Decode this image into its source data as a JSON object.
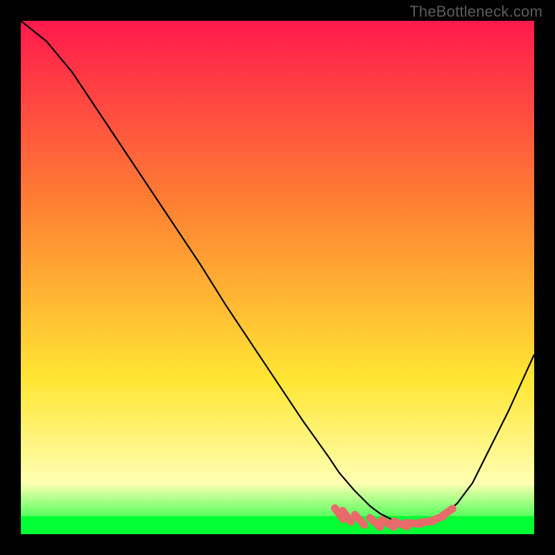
{
  "watermark": "TheBottleneck.com",
  "chart_data": {
    "type": "line",
    "title": "",
    "xlabel": "",
    "ylabel": "",
    "xlim": [
      0,
      100
    ],
    "ylim": [
      0,
      100
    ],
    "curve": {
      "name": "bottleneck-curve",
      "color": "#000000",
      "x": [
        0,
        5,
        10,
        15,
        20,
        25,
        30,
        35,
        40,
        45,
        50,
        55,
        60,
        62,
        65,
        68,
        70,
        73,
        75,
        78,
        80,
        82,
        85,
        88,
        90,
        92,
        95,
        100
      ],
      "y": [
        100,
        96,
        90,
        82.5,
        75,
        67.5,
        60,
        52.5,
        44.5,
        37,
        29.5,
        22,
        15,
        12,
        8.5,
        5.5,
        4,
        2.5,
        2,
        2,
        2.5,
        3.5,
        6,
        10,
        14,
        18,
        24,
        35
      ]
    },
    "valid_band": {
      "name": "valid-region",
      "color": "#00ff33",
      "y_range": [
        0,
        3.5
      ]
    },
    "markers": {
      "name": "valid-range-markers",
      "color": "#e96a6a",
      "points": [
        {
          "x": 62,
          "y": 4
        },
        {
          "x": 63.5,
          "y": 3.5
        },
        {
          "x": 66,
          "y": 2.8
        },
        {
          "x": 69,
          "y": 2.3
        },
        {
          "x": 71.5,
          "y": 2.1
        },
        {
          "x": 74,
          "y": 2.0
        },
        {
          "x": 76.5,
          "y": 2.1
        },
        {
          "x": 79,
          "y": 2.4
        },
        {
          "x": 81,
          "y": 3.0
        },
        {
          "x": 83,
          "y": 4.2
        }
      ]
    },
    "background_gradient": {
      "top": "#ff1a4d",
      "mid1": "#ff7e33",
      "mid2": "#ffe633",
      "mid3": "#ffffb3",
      "bottom": "#00ff33"
    }
  }
}
